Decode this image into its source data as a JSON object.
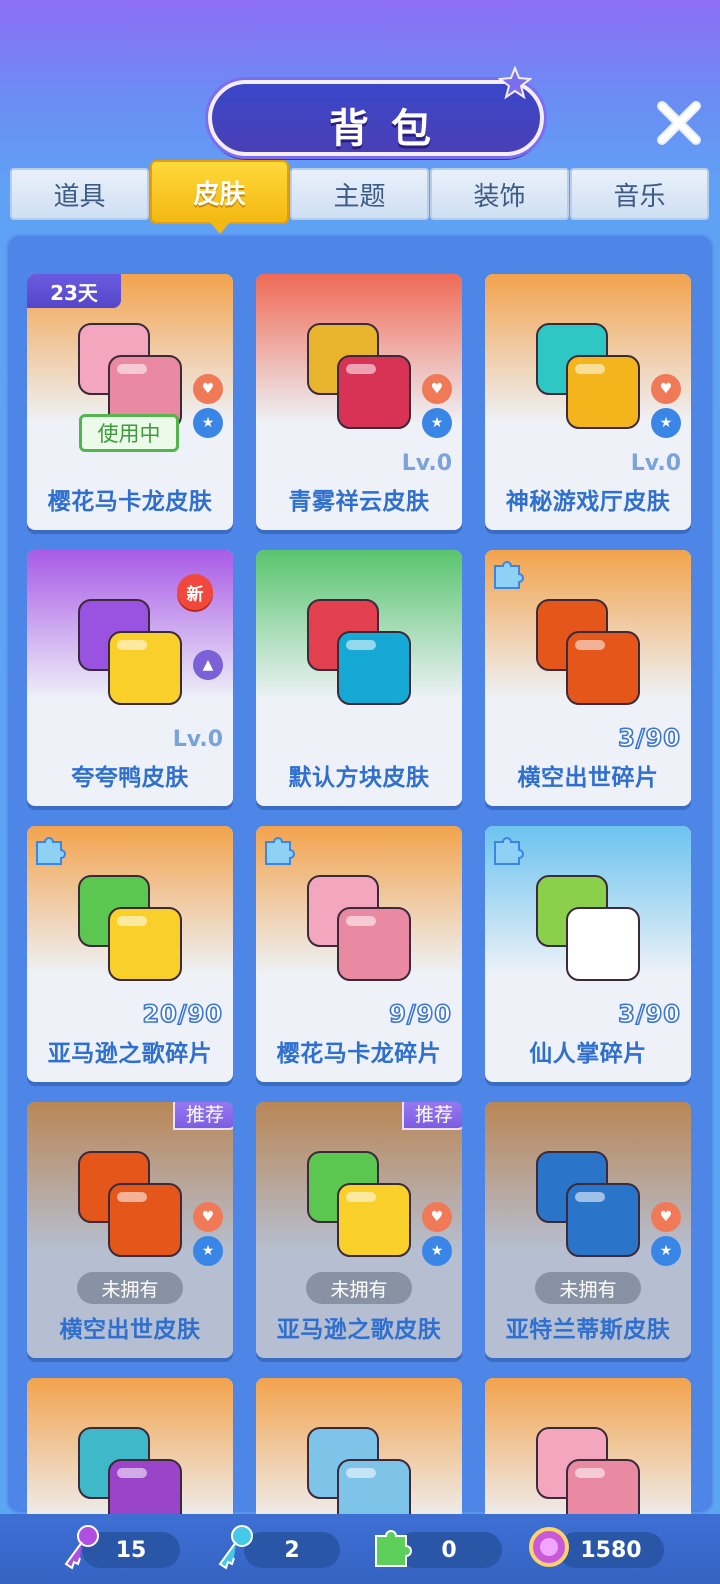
{
  "header": {
    "title": "背包"
  },
  "tabs": [
    {
      "label": "道具"
    },
    {
      "label": "皮肤"
    },
    {
      "label": "主题"
    },
    {
      "label": "装饰"
    },
    {
      "label": "音乐"
    }
  ],
  "active_tab": "皮肤",
  "items": [
    {
      "name": "樱花马卡龙皮肤",
      "tag": "23天",
      "status": "使用中",
      "colors": [
        "#f4a6bf",
        "#e98aa2"
      ],
      "bg": "#f2a34d"
    },
    {
      "name": "青雾祥云皮肤",
      "level": "Lv.0",
      "colors": [
        "#e8b42c",
        "#d83355"
      ],
      "bg": "#ef6a55"
    },
    {
      "name": "神秘游戏厅皮肤",
      "level": "Lv.0",
      "colors": [
        "#2fc7c4",
        "#f4b51c"
      ],
      "bg": "#f2a34d"
    },
    {
      "name": "夸夸鸭皮肤",
      "level": "Lv.0",
      "badge": "新",
      "colors": [
        "#9a52e0",
        "#f9cf2a"
      ],
      "bg": "#a95ae6"
    },
    {
      "name": "默认方块皮肤",
      "colors": [
        "#e2404e",
        "#16a9d6"
      ],
      "bg": "#59c46d"
    },
    {
      "name": "横空出世碎片",
      "progress": "3/90",
      "colors": [
        "#e5561b",
        "#e5561b"
      ],
      "bg": "#f2a34d"
    },
    {
      "name": "亚马逊之歌碎片",
      "progress": "20/90",
      "colors": [
        "#5bc650",
        "#f9cf2a"
      ],
      "bg": "#f2a34d"
    },
    {
      "name": "樱花马卡龙碎片",
      "progress": "9/90",
      "colors": [
        "#f4a6bf",
        "#e98aa2"
      ],
      "bg": "#f2a34d"
    },
    {
      "name": "仙人掌碎片",
      "progress": "3/90",
      "colors": [
        "#8bd04a",
        "#ffffff"
      ],
      "bg": "#6cc3ef"
    },
    {
      "name": "横空出世皮肤",
      "status": "未拥有",
      "badge": "推荐",
      "colors": [
        "#e5561b",
        "#e5561b"
      ],
      "bg": "#f2a34d"
    },
    {
      "name": "亚马逊之歌皮肤",
      "status": "未拥有",
      "badge": "推荐",
      "colors": [
        "#5bc650",
        "#f9cf2a"
      ],
      "bg": "#f2a34d"
    },
    {
      "name": "亚特兰蒂斯皮肤",
      "status": "未拥有",
      "colors": [
        "#2a74c9",
        "#2a74c9"
      ],
      "bg": "#f2a34d"
    },
    {
      "name": "",
      "colors": [
        "#3fb8c9",
        "#9a45c9"
      ],
      "bg": "#f2a34d"
    },
    {
      "name": "",
      "colors": [
        "#7ec3e8",
        "#7ec3e8"
      ],
      "bg": "#f2a34d"
    },
    {
      "name": "",
      "colors": [
        "#f4a6bf",
        "#e98aa2"
      ],
      "bg": "#f2a34d"
    }
  ],
  "currencies": [
    {
      "icon": "purple-key-icon",
      "value": "15"
    },
    {
      "icon": "blue-key-icon",
      "value": "2"
    },
    {
      "icon": "puzzle-piece-icon",
      "value": "0"
    },
    {
      "icon": "gem-icon",
      "value": "1580"
    }
  ]
}
